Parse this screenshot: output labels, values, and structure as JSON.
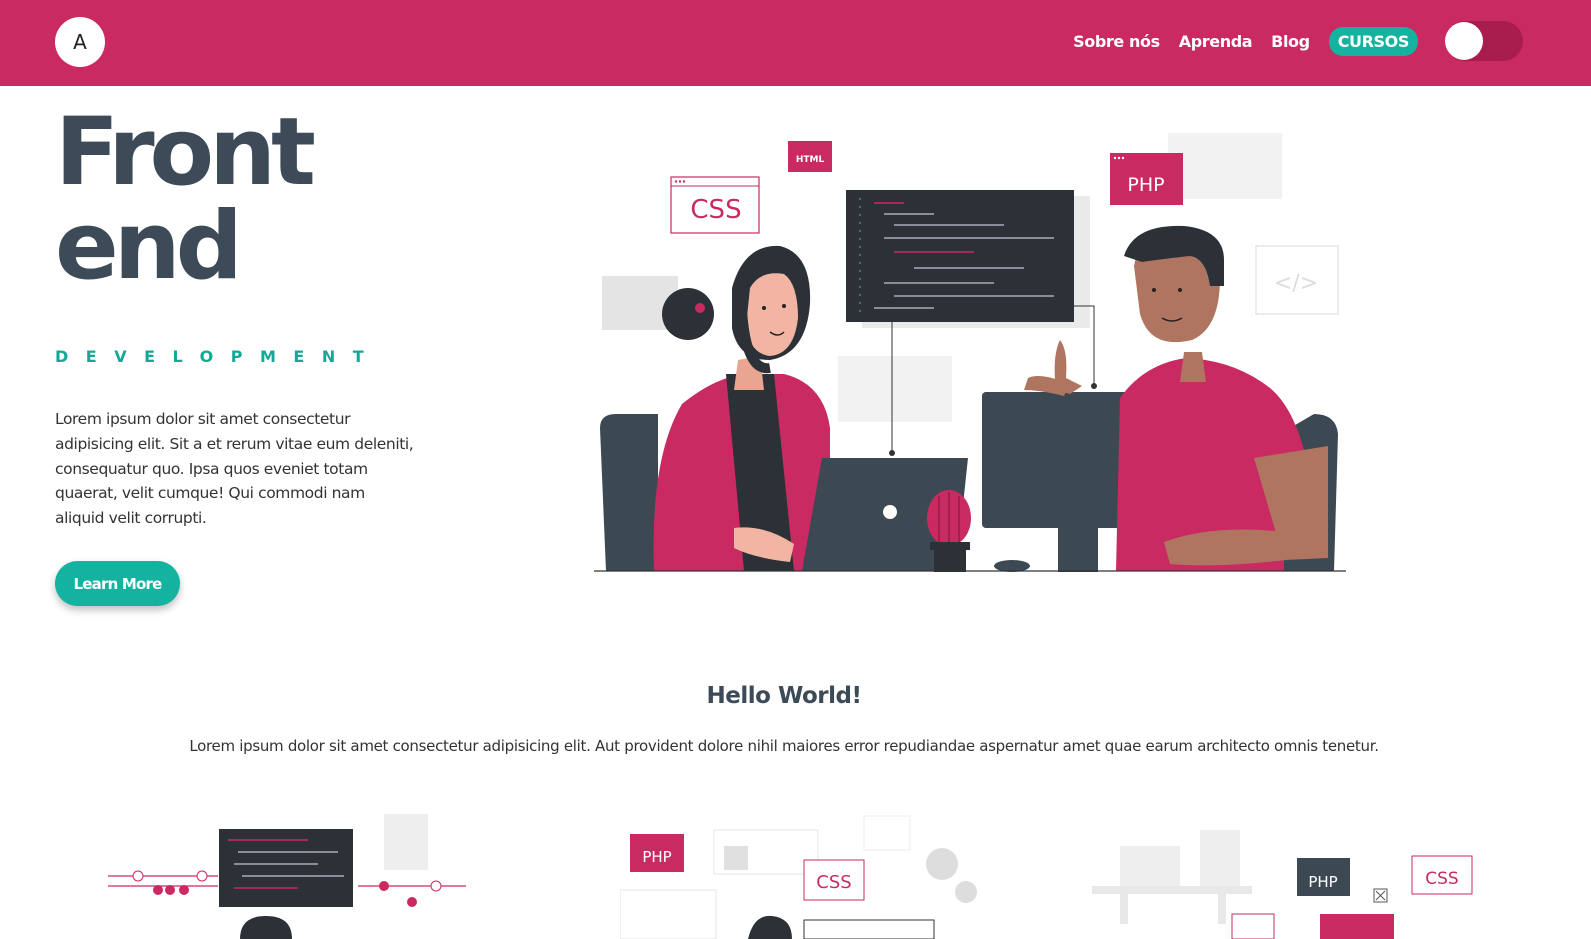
{
  "header": {
    "logo_letter": "A",
    "nav": [
      {
        "label": "Sobre nós"
      },
      {
        "label": "Aprenda"
      },
      {
        "label": "Blog"
      },
      {
        "label": "CURSOS"
      }
    ],
    "toggle_state": "off"
  },
  "hero": {
    "title_line1": "Front",
    "title_line2": "end",
    "subtitle": "DEVELOPMENT",
    "text": "Lorem ipsum dolor sit amet consectetur adipisicing elit. Sit a et rerum vitae eum deleniti, consequatur quo. Ipsa quos eveniet totam quaerat, velit cumque! Qui commodi nam aliquid velit corrupti.",
    "button": "Learn More",
    "illustration": {
      "badges": [
        "CSS",
        "HTML",
        "PHP"
      ]
    }
  },
  "intro": {
    "title": "Hello World!",
    "text": "Lorem ipsum dolor sit amet consectetur adipisicing elit. Aut provident dolore nihil maiores error repudiandae aspernatur amet quae earum architecto omnis tenetur."
  },
  "cards": {
    "illustration_badges": [
      "PHP",
      "CSS",
      "PHP",
      "CSS"
    ]
  },
  "colors": {
    "brand": "#c92a62",
    "accent": "#14b3a0",
    "dark": "#3c4b57"
  }
}
